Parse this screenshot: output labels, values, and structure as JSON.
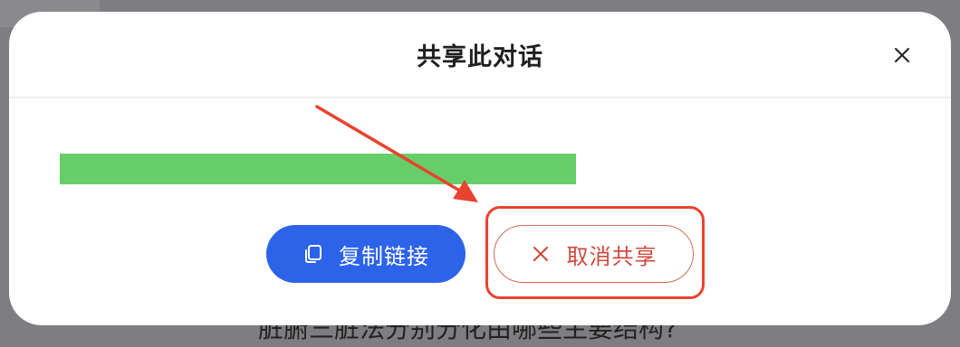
{
  "dialog": {
    "title": "共享此对话",
    "close_icon": "close-icon"
  },
  "actions": {
    "copy_link_label": "复制链接",
    "copy_icon": "copy-icon",
    "cancel_share_label": "取消共享",
    "cancel_icon": "x-icon"
  },
  "background": {
    "partial_text": "脏腑三脏法分别分化由哪些主要结构?"
  },
  "colors": {
    "primary_button": "#2c63e9",
    "cancel_button_text": "#cf4a3c",
    "link_placeholder_bar": "#66cf69",
    "annotation_red": "#e8432f"
  }
}
